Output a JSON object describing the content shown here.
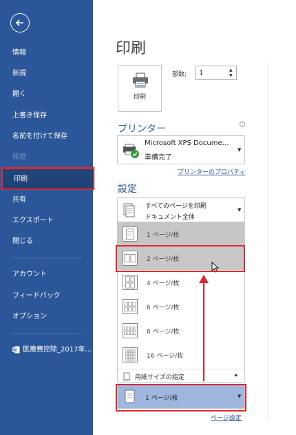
{
  "sidebar": {
    "items": [
      {
        "label": "情報"
      },
      {
        "label": "新規"
      },
      {
        "label": "開く"
      },
      {
        "label": "上書き保存"
      },
      {
        "label": "名前を付けて保存"
      },
      {
        "label": "履歴"
      },
      {
        "label": "印刷"
      },
      {
        "label": "共有"
      },
      {
        "label": "エクスポート"
      },
      {
        "label": "閉じる"
      },
      {
        "label": "アカウント"
      },
      {
        "label": "フィードバック"
      },
      {
        "label": "オプション"
      }
    ],
    "recent_file": "医療費控除_2017年…"
  },
  "main": {
    "title": "印刷",
    "print_button": "印刷",
    "copies_label": "部数:",
    "copies_value": "1",
    "printer_section": "プリンター",
    "printer_name": "Microsoft XPS Docume…",
    "printer_status": "準備完了",
    "printer_props_link": "プリンターのプロパティ",
    "settings_section": "設定",
    "print_range_main": "すべてのページを印刷",
    "print_range_sub": "ドキュメント全体",
    "pages_per_sheet_options": [
      {
        "label": "1 ページ/枚"
      },
      {
        "label": "2 ページ/枚"
      },
      {
        "label": "4 ページ/枚"
      },
      {
        "label": "6 ページ/枚"
      },
      {
        "label": "8 ページ/枚"
      },
      {
        "label": "16 ページ/枚"
      }
    ],
    "paper_size_option": "用紙サイズの指定",
    "pages_per_sheet_value": "1 ページ/枚",
    "page_setup_link": "ページ設定"
  },
  "colors": {
    "sidebar": "#2b579a",
    "accent": "#2b579a",
    "highlight": "#e0262f",
    "selected_box": "#9fb7de"
  }
}
